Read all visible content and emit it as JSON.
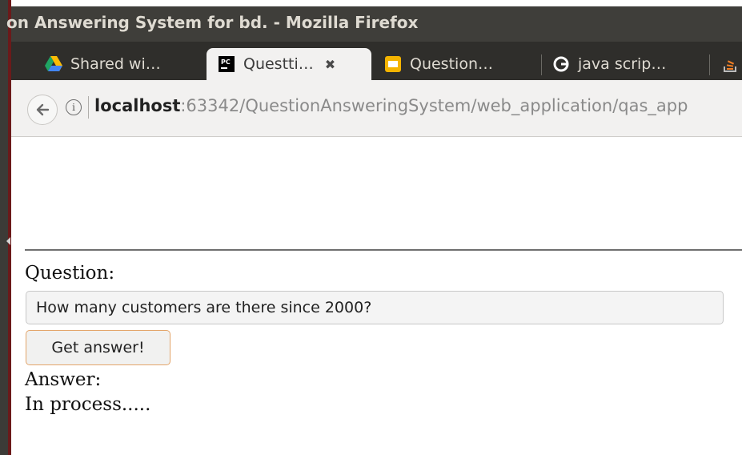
{
  "window": {
    "title": "on Answering System for bd. - Mozilla Firefox"
  },
  "tabs": [
    {
      "label": "Shared wi…",
      "icon": "google-drive-icon",
      "active": false
    },
    {
      "label": "Questti…",
      "icon": "pycharm-icon",
      "active": true
    },
    {
      "label": "Question…",
      "icon": "google-slides-icon",
      "active": false
    },
    {
      "label": "java scrip…",
      "icon": "google-icon",
      "active": false
    },
    {
      "label": "",
      "icon": "stackoverflow-icon",
      "active": false
    }
  ],
  "navbar": {
    "url_host": "localhost",
    "url_rest": ":63342/QuestionAnsweringSystem/web_application/qas_app"
  },
  "page": {
    "question_label": "Question:",
    "question_value": "How many customers are there since 2000?",
    "button_label": "Get answer!",
    "answer_label": "Answer:",
    "answer_text": "In process....."
  },
  "colors": {
    "titlebar": "#3f3e3a",
    "tabbar": "#2f2e2b",
    "accent_border": "#e3a56a"
  }
}
